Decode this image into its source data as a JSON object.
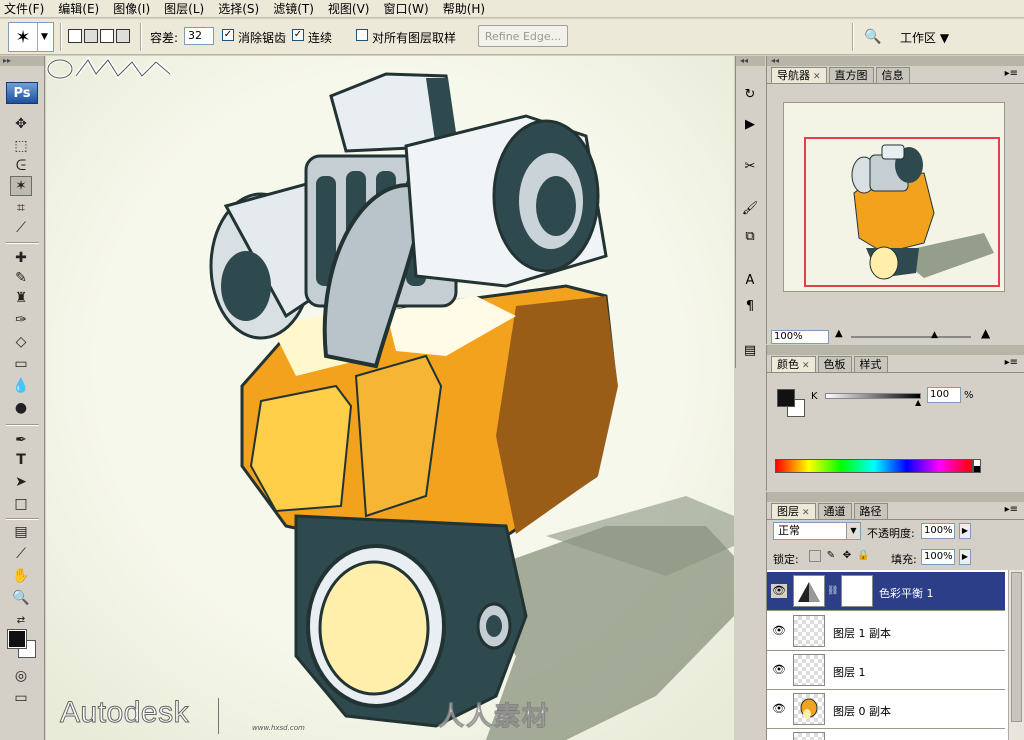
{
  "menubar": {
    "items": [
      "文件(F)",
      "编辑(E)",
      "图像(I)",
      "图层(L)",
      "选择(S)",
      "滤镜(T)",
      "视图(V)",
      "窗口(W)",
      "帮助(H)"
    ]
  },
  "options": {
    "tolerance_label": "容差:",
    "tolerance_value": "32",
    "antialias_label": "消除锯齿",
    "contiguous_label": "连续",
    "sample_all_label": "对所有图层取样",
    "refine_edge": "Refine Edge...",
    "workspace_label": "工作区 ▼"
  },
  "toolbox": {
    "logo": "Ps"
  },
  "canvas": {
    "watermark_autodesk": "Autodesk",
    "watermark_hx_url": "www.hxsd.com",
    "watermark_rrsc": "人人素材"
  },
  "navigator": {
    "tabs": [
      "导航器",
      "直方图",
      "信息"
    ],
    "zoom": "100%"
  },
  "color": {
    "tabs": [
      "颜色",
      "色板",
      "样式"
    ],
    "k_label": "K",
    "k_value": "100",
    "k_unit": "%"
  },
  "layers": {
    "tabs": [
      "图层",
      "通道",
      "路径"
    ],
    "blend_mode": "正常",
    "opacity_label": "不透明度:",
    "opacity_value": "100%",
    "lock_label": "锁定:",
    "fill_label": "填充:",
    "fill_value": "100%",
    "rows": [
      {
        "name": "色彩平衡 1",
        "selected": true
      },
      {
        "name": "图层 1 副本",
        "selected": false
      },
      {
        "name": "图层 1",
        "selected": false
      },
      {
        "name": "图层 0 副本",
        "selected": false
      }
    ]
  },
  "colors": {
    "accent_selected_layer": "#2c3e88",
    "robot_orange": "#f2a21c",
    "robot_slate": "#2f4a4e",
    "canvas_bg": "#f7f8ec"
  }
}
